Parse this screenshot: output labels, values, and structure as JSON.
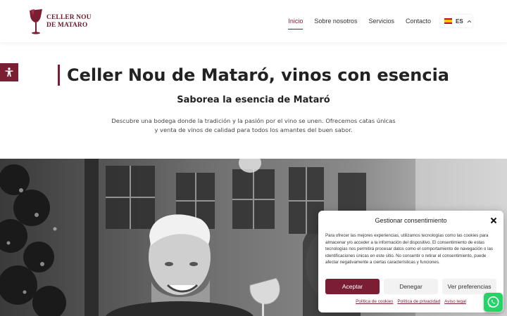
{
  "header": {
    "logo": {
      "line1": "CELLER NOU",
      "line2": "DE MATARO",
      "icon": "wine-glass-logo"
    },
    "nav": [
      {
        "label": "Inicio",
        "active": true
      },
      {
        "label": "Sobre nosotros",
        "active": false
      },
      {
        "label": "Servicios",
        "active": false
      },
      {
        "label": "Contacto",
        "active": false
      }
    ],
    "language": {
      "code": "ES",
      "flag": "spain-flag-icon",
      "caret": "chevron-up-icon"
    }
  },
  "accessibility": {
    "icon": "accessibility-icon"
  },
  "hero": {
    "title": "Celler Nou de Mataró, vinos con esencia",
    "subtitle": "Saborea la esencia de Mataró",
    "description": "Descubre una bodega donde la tradición y la pasión por el vino se unen. Ofrecemos catas únicas y venta de vinos de calidad para todos los amantes del buen sabor."
  },
  "consent": {
    "title": "Gestionar consentimiento",
    "text": "Para ofrecer las mejores experiencias, utilizamos tecnologías como las cookies para almacenar y/o acceder a la información del dispositivo. El consentimiento de estas tecnologías nos permitirá procesar datos como el comportamiento de navegación o las identificaciones únicas en este sitio. No consentir o retirar el consentimiento, puede afectar negativamente a ciertas características y funciones.",
    "buttons": {
      "accept": "Aceptar",
      "deny": "Denegar",
      "preferences": "Ver preferencias"
    },
    "links": {
      "cookies": "Política de cookies",
      "privacy": "Política de privacidad",
      "legal": "Aviso legal"
    }
  },
  "whatsapp": {
    "icon": "whatsapp-icon"
  },
  "colors": {
    "brand": "#7b1e33",
    "whatsapp": "#25d366"
  }
}
